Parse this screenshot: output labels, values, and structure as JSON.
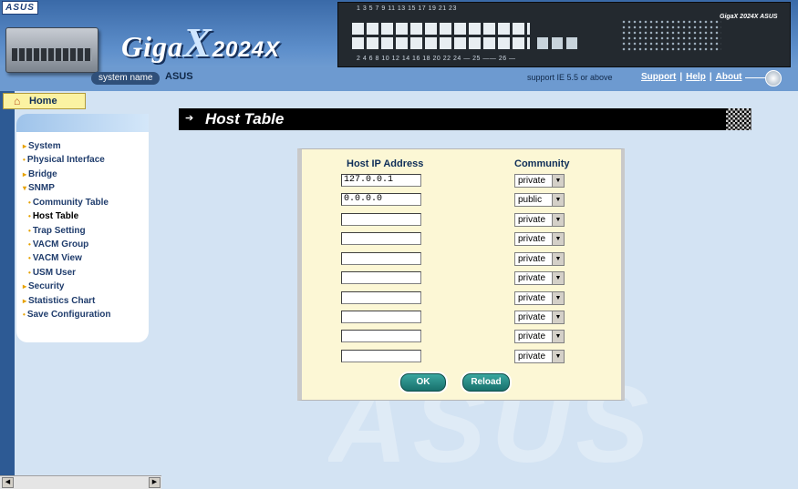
{
  "header": {
    "asus_logo": "ASUS",
    "brand": {
      "prefix": "Giga",
      "x": "X",
      "model": "2024X"
    },
    "panel_top_numbers": "1   3   5   7    9   11   13   15    17   19   21  23",
    "panel_bottom_numbers": "2   4   6   8   10  12  14  16   18  20  22  24  — 25 —— 26 —",
    "panel_brand": "GigaX 2024X ASUS",
    "system_name_label": "system name",
    "system_name_value": "ASUS",
    "support_note": "support IE 5.5 or above",
    "links": [
      "Support",
      "Help",
      "About"
    ]
  },
  "nav": {
    "home_label": "Home",
    "items": [
      {
        "label": "System",
        "bullet": "▸"
      },
      {
        "label": "Physical Interface",
        "bullet": "•"
      },
      {
        "label": "Bridge",
        "bullet": "▸"
      },
      {
        "label": "SNMP",
        "bullet": "▾"
      },
      {
        "label": "Community Table",
        "bullet": "•"
      },
      {
        "label": "Host Table",
        "bullet": "•",
        "active": true
      },
      {
        "label": "Trap Setting",
        "bullet": "•"
      },
      {
        "label": "VACM Group",
        "bullet": "•"
      },
      {
        "label": "VACM View",
        "bullet": "•"
      },
      {
        "label": "USM User",
        "bullet": "•"
      },
      {
        "label": "Security",
        "bullet": "▸"
      },
      {
        "label": "Statistics Chart",
        "bullet": "▸"
      },
      {
        "label": "Save Configuration",
        "bullet": "•"
      }
    ]
  },
  "main": {
    "title": "Host Table",
    "columns": {
      "ip": "Host IP Address",
      "community": "Community"
    },
    "rows": [
      {
        "ip": "127.0.0.1",
        "community": "private"
      },
      {
        "ip": "0.0.0.0",
        "community": "public"
      },
      {
        "ip": "",
        "community": "private"
      },
      {
        "ip": "",
        "community": "private"
      },
      {
        "ip": "",
        "community": "private"
      },
      {
        "ip": "",
        "community": "private"
      },
      {
        "ip": "",
        "community": "private"
      },
      {
        "ip": "",
        "community": "private"
      },
      {
        "ip": "",
        "community": "private"
      },
      {
        "ip": "",
        "community": "private"
      }
    ],
    "ok_label": "OK",
    "reload_label": "Reload"
  },
  "watermark": "ASUS",
  "colors": {
    "accent_teal": "#18706c",
    "panel_bg": "#fcf7d5",
    "nav_text": "#1f3c6c"
  }
}
